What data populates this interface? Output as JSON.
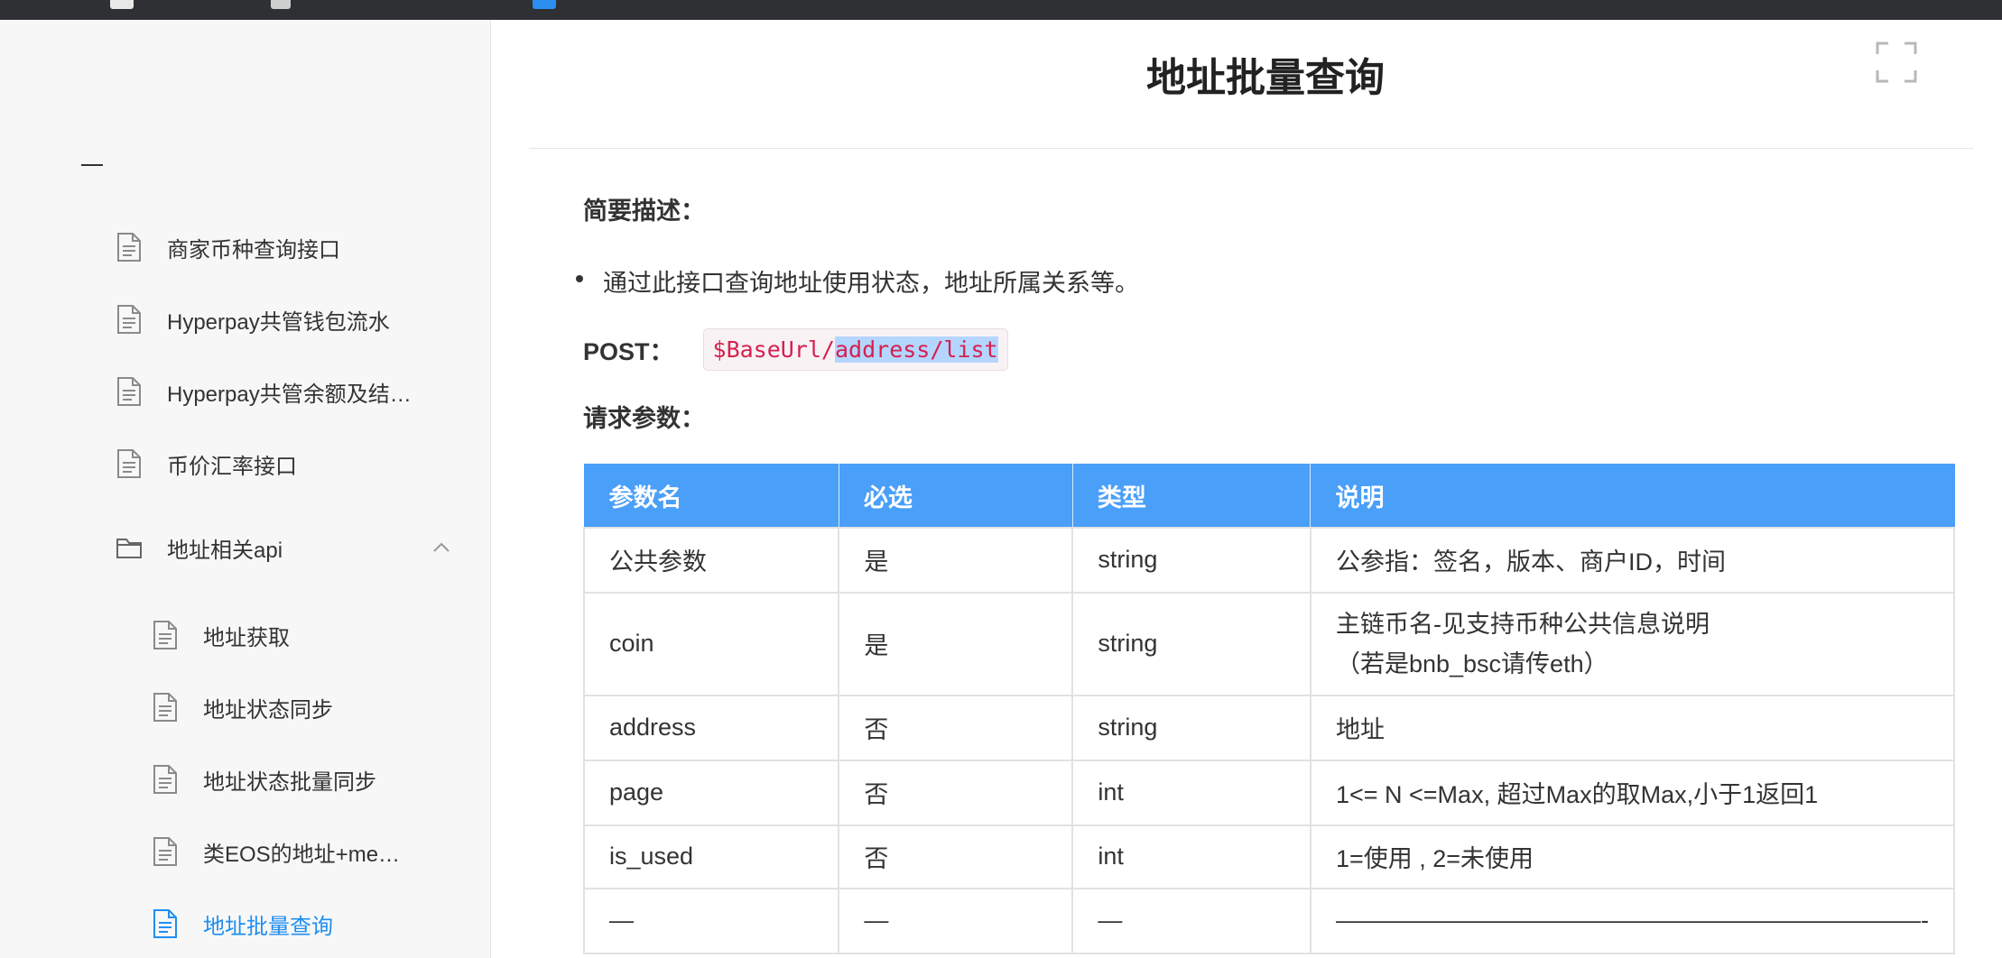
{
  "sidebar": {
    "items": [
      {
        "label": "商家币种查询接口",
        "icon": "document-icon",
        "level": 1,
        "active": false
      },
      {
        "label": "Hyperpay共管钱包流水",
        "icon": "document-icon",
        "level": 1,
        "active": false
      },
      {
        "label": "Hyperpay共管余额及结…",
        "icon": "document-icon",
        "level": 1,
        "active": false
      },
      {
        "label": "币价汇率接口",
        "icon": "document-icon",
        "level": 1,
        "active": false
      },
      {
        "label": "地址相关api",
        "icon": "folder-icon",
        "level": 1,
        "active": false,
        "expanded": true
      },
      {
        "label": "地址获取",
        "icon": "document-icon",
        "level": 2,
        "active": false
      },
      {
        "label": "地址状态同步",
        "icon": "document-icon",
        "level": 2,
        "active": false
      },
      {
        "label": "地址状态批量同步",
        "icon": "document-icon",
        "level": 2,
        "active": false
      },
      {
        "label": "类EOS的地址+me…",
        "icon": "document-icon",
        "level": 2,
        "active": false
      },
      {
        "label": "地址批量查询",
        "icon": "document-icon",
        "level": 2,
        "active": true
      }
    ]
  },
  "main": {
    "title": "地址批量查询",
    "summary_heading": "简要描述：",
    "summary_bullet": "通过此接口查询地址使用状态，地址所属关系等。",
    "method_label": "POST：",
    "endpoint_prefix": "$BaseUrl/",
    "endpoint_selected": "address/list",
    "params_heading": "请求参数：",
    "table": {
      "headers": [
        "参数名",
        "必选",
        "类型",
        "说明"
      ],
      "rows": [
        [
          "公共参数",
          "是",
          "string",
          "公参指：签名，版本、商户ID，时间"
        ],
        [
          "coin",
          "是",
          "string",
          "主链币名-见支持币种公共信息说明",
          "（若是bnb_bsc请传eth）"
        ],
        [
          "address",
          "否",
          "string",
          "地址"
        ],
        [
          "page",
          "否",
          "int",
          "1<= N <=Max, 超过Max的取Max,小于1返回1"
        ],
        [
          "is_used",
          "否",
          "int",
          "1=使用 , 2=未使用"
        ],
        [
          "—",
          "—",
          "—",
          "————————————————————————-"
        ]
      ]
    }
  },
  "colors": {
    "accent": "#1f8ef0",
    "table_header": "#4a9ff8",
    "code_text": "#d6204f",
    "topbar": "#2f3033"
  }
}
